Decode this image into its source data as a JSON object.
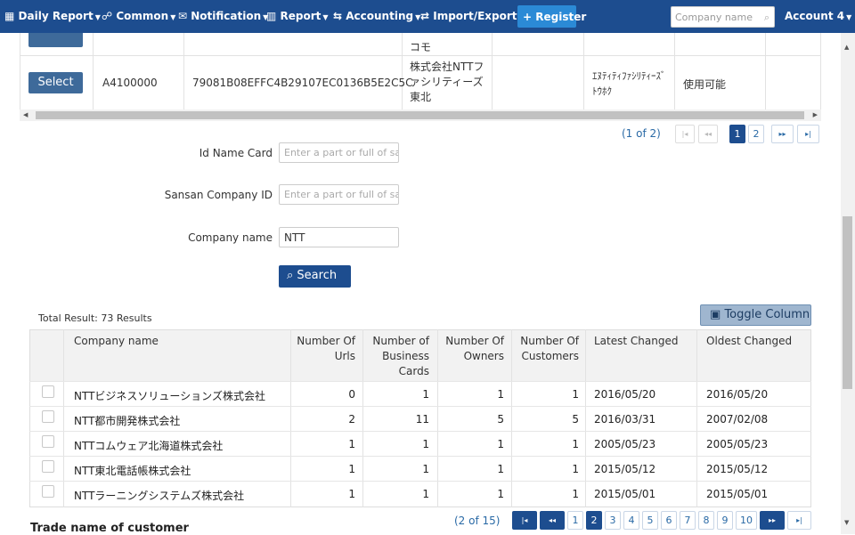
{
  "nav": {
    "items": [
      {
        "label": "Daily Report",
        "icon": "calendar-icon"
      },
      {
        "label": "Common",
        "icon": "users-icon"
      },
      {
        "label": "Notification",
        "icon": "envelope-icon"
      },
      {
        "label": "Report",
        "icon": "bar-chart-icon"
      },
      {
        "label": "Accounting",
        "icon": "exchange-icon"
      },
      {
        "label": "Import/Export",
        "icon": "arrows-icon"
      }
    ],
    "register_label": "Register",
    "company_search_placeholder": "Company name",
    "account_label": "Account 4"
  },
  "top_table": {
    "partial_text": "コモ",
    "row": {
      "select_label": "Select",
      "code": "A4100000",
      "hash": "79081B08EFFC4B29107EC0136B5E2C5C",
      "company": "株式会社NTTファシリティーズ東北",
      "kana": "ｴﾇﾃｨﾃｨﾌｧｼﾘﾃｨｰｽﾞﾄｳﾎｸ",
      "status": "使用可能"
    },
    "pagination": {
      "info": "(1 of 2)",
      "first": "|◂",
      "prev": "◂◂",
      "pages": [
        "1",
        "2"
      ],
      "next": "▸▸",
      "last": "▸|"
    }
  },
  "form": {
    "id_name_card_label": "Id Name Card",
    "id_name_card_placeholder": "Enter a part or full of sample",
    "sansan_id_label": "Sansan Company ID",
    "sansan_id_placeholder": "Enter a part or full of sample",
    "company_name_label": "Company name",
    "company_name_value": "NTT",
    "search_label": "Search"
  },
  "results": {
    "total": "Total Result: 73 Results",
    "toggle_label": "Toggle Column",
    "columns": [
      "Company name",
      "Number Of Urls",
      "Number of Business Cards",
      "Number Of Owners",
      "Number Of Customers",
      "Latest Changed",
      "Oldest Changed"
    ],
    "rows": [
      {
        "name": "NTTビジネスソリューションズ株式会社",
        "urls": "0",
        "cards": "1",
        "owners": "1",
        "customers": "1",
        "latest": "2016/05/20",
        "oldest": "2016/05/20"
      },
      {
        "name": "NTT都市開発株式会社",
        "urls": "2",
        "cards": "11",
        "owners": "5",
        "customers": "5",
        "latest": "2016/03/31",
        "oldest": "2007/02/08"
      },
      {
        "name": "NTTコムウェア北海道株式会社",
        "urls": "1",
        "cards": "1",
        "owners": "1",
        "customers": "1",
        "latest": "2005/05/23",
        "oldest": "2005/05/23"
      },
      {
        "name": "NTT東北電話帳株式会社",
        "urls": "1",
        "cards": "1",
        "owners": "1",
        "customers": "1",
        "latest": "2015/05/12",
        "oldest": "2015/05/12"
      },
      {
        "name": "NTTラーニングシステムズ株式会社",
        "urls": "1",
        "cards": "1",
        "owners": "1",
        "customers": "1",
        "latest": "2015/05/01",
        "oldest": "2015/05/01"
      }
    ],
    "pagination": {
      "info": "(2 of 15)",
      "first": "|◂",
      "prev": "◂◂",
      "pages": [
        "1",
        "2",
        "3",
        "4",
        "5",
        "6",
        "7",
        "8",
        "9",
        "10"
      ],
      "next": "▸▸",
      "last": "▸|"
    }
  },
  "trade_name_heading": "Trade name of customer"
}
